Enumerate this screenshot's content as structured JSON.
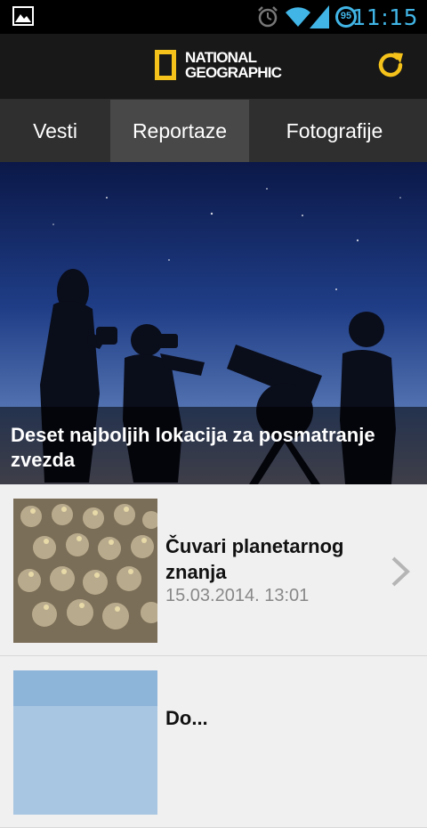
{
  "status_bar": {
    "time": "11:15",
    "battery_level": "95",
    "icons": [
      "image-notification-icon",
      "alarm-icon",
      "wifi-icon",
      "signal-icon",
      "battery-icon"
    ]
  },
  "header": {
    "logo_line1": "NATIONAL",
    "logo_line2": "GEOGRAPHIC",
    "refresh_icon": "refresh-icon",
    "brand_color": "#f4c21a"
  },
  "tabs": [
    {
      "label": "Vesti",
      "active": false
    },
    {
      "label": "Reportaze",
      "active": true
    },
    {
      "label": "Fotografije",
      "active": false
    }
  ],
  "featured": {
    "title": "Deset najboljih lokacija za posmatranje zvezda"
  },
  "articles": [
    {
      "title": "Čuvari planetarnog znanja",
      "date": "15.03.2014. 13:01"
    },
    {
      "title": "Do..."
    }
  ]
}
